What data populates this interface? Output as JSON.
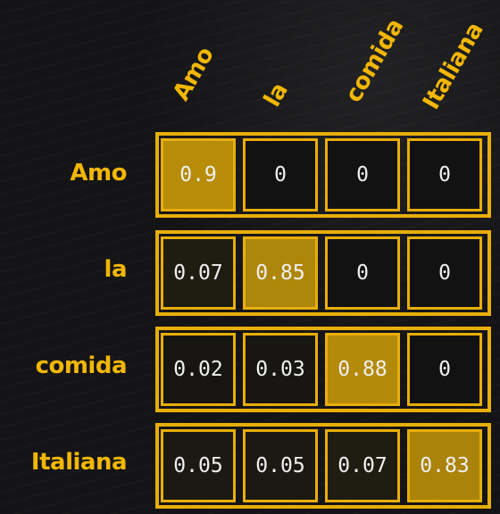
{
  "chart_data": {
    "type": "heatmap",
    "x_labels": [
      "Amo",
      "la",
      "comida",
      "Italiana"
    ],
    "y_labels": [
      "Amo",
      "la",
      "comida",
      "Italiana"
    ],
    "values": [
      [
        "0.9",
        "0",
        "0",
        "0"
      ],
      [
        "0.07",
        "0.85",
        "0",
        "0"
      ],
      [
        "0.02",
        "0.03",
        "0.88",
        "0"
      ],
      [
        "0.05",
        "0.05",
        "0.07",
        "0.83"
      ]
    ],
    "colors": {
      "accent": "#e8ae09",
      "label": "#f2b705",
      "cell_max": "#c99a08",
      "cell_min": "#121212",
      "text": "#f0f0f0"
    }
  }
}
